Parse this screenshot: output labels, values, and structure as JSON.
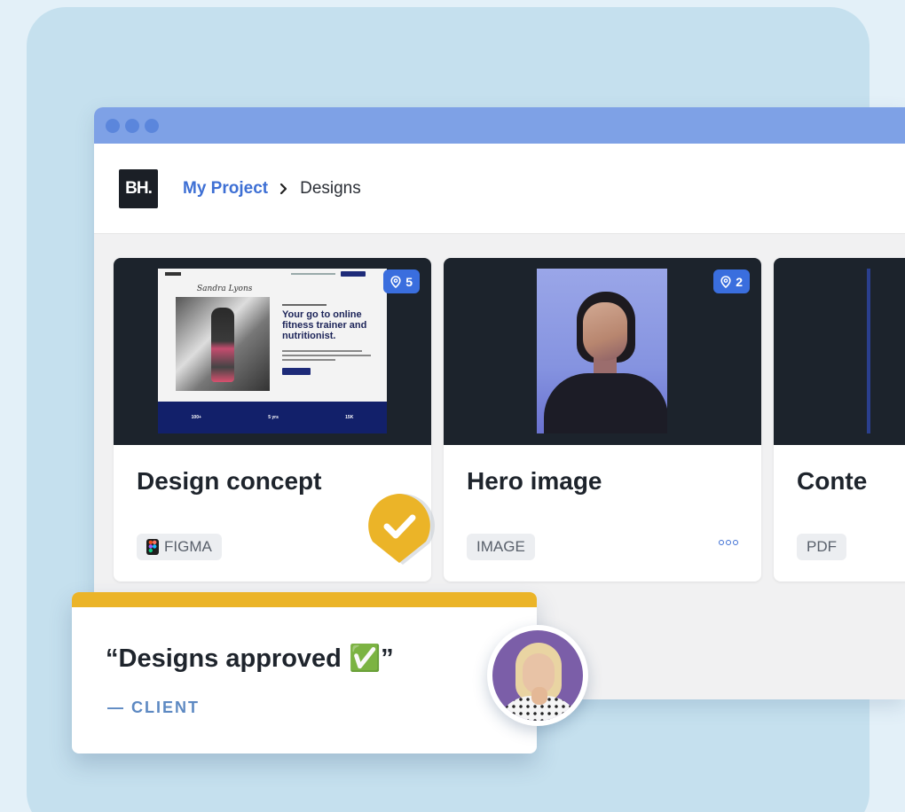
{
  "window": {
    "dots": 3
  },
  "header": {
    "logo_text": "BH.",
    "breadcrumb": {
      "project": "My Project",
      "current": "Designs"
    }
  },
  "cards": [
    {
      "title": "Design concept",
      "pin_count": "5",
      "tag": "FIGMA",
      "tag_icon": "figma-icon",
      "approved": true,
      "preview": {
        "script_title": "Sandra Lyons",
        "headline": "Your go to online fitness trainer and nutritionist.",
        "stats": [
          "100+",
          "5 yrs",
          "15K"
        ]
      }
    },
    {
      "title": "Hero image",
      "pin_count": "2",
      "tag": "IMAGE",
      "more_icon": "more-horizontal-icon"
    },
    {
      "title": "Conte",
      "tag": "PDF"
    }
  ],
  "quote": {
    "text": "“Designs approved ✅”",
    "attribution": "— CLIENT"
  },
  "colors": {
    "accent_blue": "#3d6fd4",
    "titlebar": "#7ea1e6",
    "approval_yellow": "#ebb428",
    "background": "#c5e0ee"
  }
}
